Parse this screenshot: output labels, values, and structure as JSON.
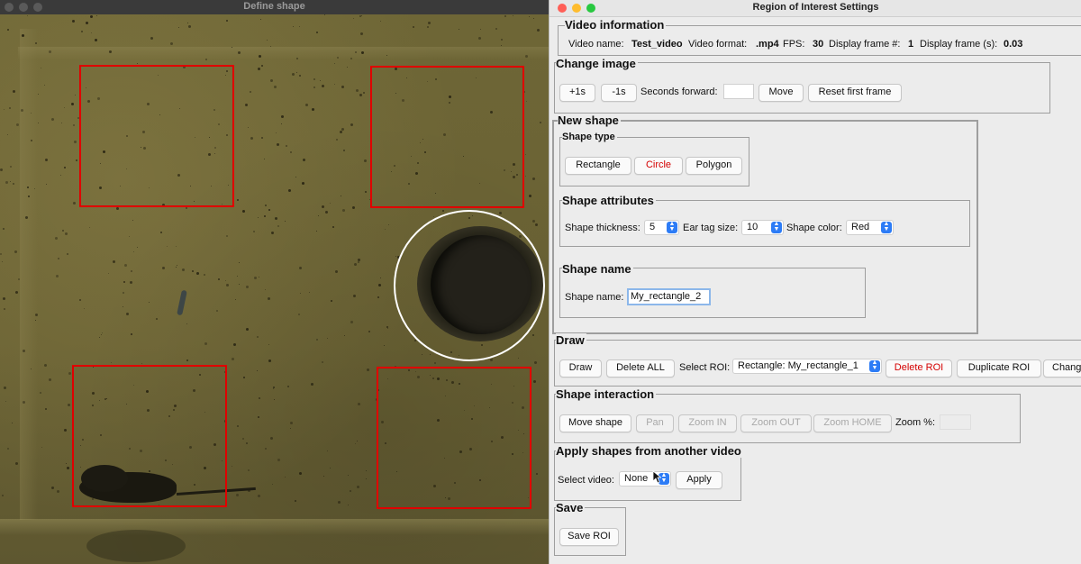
{
  "left_window": {
    "title": "Define shape"
  },
  "right_window": {
    "title": "Region of Interest Settings",
    "video_information": {
      "title": "Video information",
      "video_name_label": "Video name:",
      "video_name": "Test_video",
      "video_format_label": "Video format:",
      "video_format": ".mp4",
      "fps_label": "FPS:",
      "fps": "30",
      "display_frame_label": "Display frame #:",
      "display_frame": "1",
      "display_frame_s_label": "Display frame (s):",
      "display_frame_s": "0.03"
    },
    "change_image": {
      "title": "Change image",
      "plus_label": "+1s",
      "minus_label": "-1s",
      "seconds_forward_label": "Seconds forward:",
      "seconds_forward_value": "",
      "move_label": "Move",
      "reset_label": "Reset first frame"
    },
    "new_shape": {
      "title": "New shape",
      "shape_type": {
        "title": "Shape type",
        "rectangle_label": "Rectangle",
        "circle_label": "Circle",
        "polygon_label": "Polygon",
        "selected": "Circle"
      },
      "shape_attributes": {
        "title": "Shape attributes",
        "thickness_label": "Shape thickness:",
        "thickness_value": "5",
        "ear_tag_label": "Ear tag size:",
        "ear_tag_value": "10",
        "color_label": "Shape color:",
        "color_value": "Red"
      },
      "shape_name": {
        "title": "Shape name",
        "label": "Shape name:",
        "value": "My_rectangle_2"
      }
    },
    "draw": {
      "title": "Draw",
      "draw_label": "Draw",
      "delete_all_label": "Delete ALL",
      "select_roi_label": "Select ROI:",
      "select_roi_value": "Rectangle: My_rectangle_1",
      "delete_roi_label": "Delete ROI",
      "duplicate_roi_label": "Duplicate ROI",
      "change_label": "Change"
    },
    "shape_interaction": {
      "title": "Shape interaction",
      "move_shape_label": "Move shape",
      "pan_label": "Pan",
      "zoom_in_label": "Zoom IN",
      "zoom_out_label": "Zoom OUT",
      "zoom_home_label": "Zoom HOME",
      "zoom_pct_label": "Zoom %:",
      "zoom_pct_value": ""
    },
    "apply_shapes": {
      "title": "Apply shapes from another video",
      "select_video_label": "Select video:",
      "select_video_value": "None",
      "apply_label": "Apply"
    },
    "save": {
      "title": "Save",
      "save_roi_label": "Save ROI"
    }
  },
  "colors": {
    "roi_rectangle": "#e00000",
    "roi_circle": "#ffffff",
    "accent": "#2d7cf6",
    "traffic_close": "#ff5f57",
    "traffic_min": "#febc2e",
    "traffic_max": "#28c840"
  }
}
